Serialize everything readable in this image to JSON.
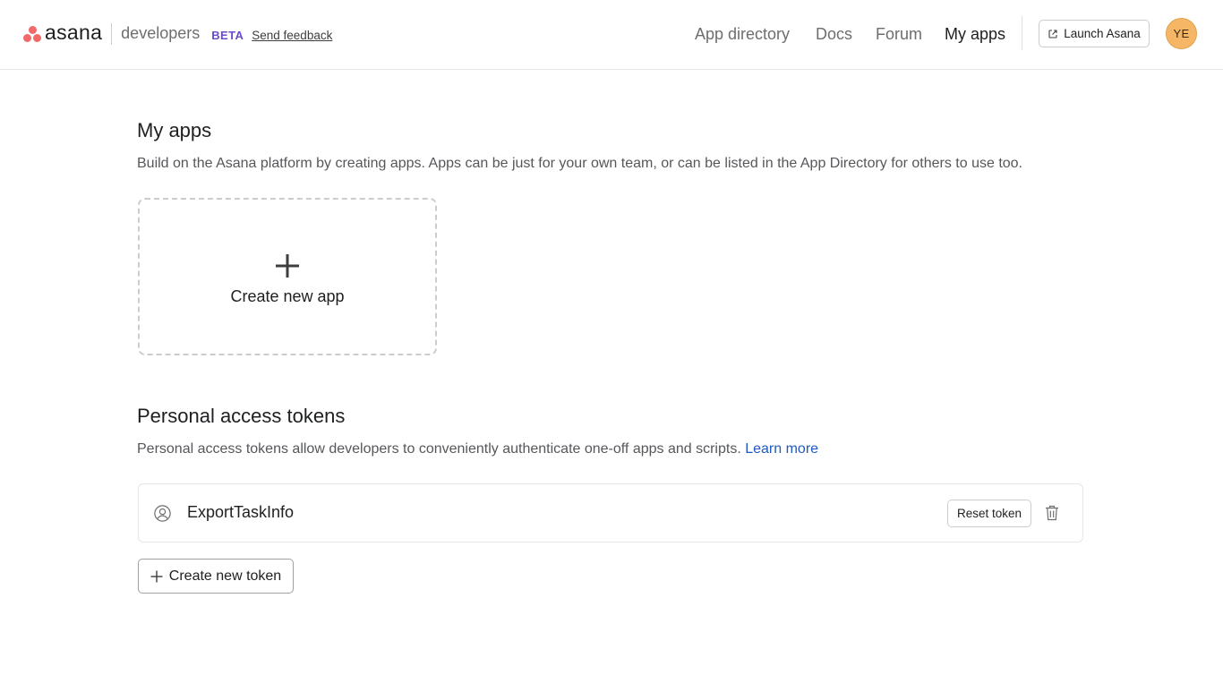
{
  "header": {
    "logo_text": "asana",
    "sub_brand": "developers",
    "badge": "BETA",
    "feedback_link": "Send feedback",
    "nav": [
      {
        "label": "App directory"
      },
      {
        "label": "Docs"
      },
      {
        "label": "Forum"
      },
      {
        "label": "My apps"
      }
    ],
    "launch_button": "Launch Asana",
    "avatar_initials": "YE"
  },
  "my_apps": {
    "title": "My apps",
    "description": "Build on the Asana platform by creating apps. Apps can be just for your own team, or can be listed in the App Directory for others to use too.",
    "create_card_label": "Create new app"
  },
  "tokens": {
    "title": "Personal access tokens",
    "description": "Personal access tokens allow developers to conveniently authenticate one-off apps and scripts.",
    "learn_more": "Learn more",
    "items": [
      {
        "name": "ExportTaskInfo",
        "reset_label": "Reset token"
      }
    ],
    "create_button": "Create new token"
  },
  "colors": {
    "brand": "#f06a6a",
    "beta": "#6a4cc9",
    "link": "#1f5ac2",
    "avatar": "#f5b766"
  }
}
